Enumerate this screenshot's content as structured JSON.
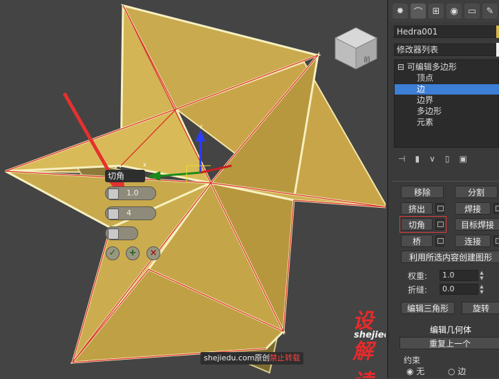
{
  "viewport": {
    "axis_z": "z",
    "axis_x": "x",
    "caddy": {
      "title": "切角",
      "amount": "1.0",
      "segments": "4"
    },
    "watermark": {
      "site": "shejiedu.com原创",
      "warning": "禁止转载"
    },
    "logo": {
      "big": "设解读",
      "small": "shejiedu.com"
    },
    "viewcube_label": "前"
  },
  "panel": {
    "object_name": "Hedra001",
    "modifier_list": "修改器列表",
    "stack": {
      "root": "可编辑多边形",
      "items": [
        "顶点",
        "边",
        "边界",
        "多边形",
        "元素"
      ],
      "selected": "边"
    },
    "edit_edges": {
      "remove": "移除",
      "split": "分割",
      "extrude": "挤出",
      "weld": "焊接",
      "chamfer": "切角",
      "target_weld": "目标焊接",
      "bridge": "桥",
      "connect": "连接",
      "create_shape": "利用所选内容创建图形",
      "weight_label": "权重:",
      "weight_value": "1.0",
      "crease_label": "折缝:",
      "crease_value": "0.0",
      "edit_tri": "编辑三角形",
      "turn": "旋转"
    },
    "edit_geometry": {
      "title": "编辑几何体",
      "repeat_last": "重复上一个",
      "constraints_label": "约束",
      "none": "无",
      "edge": "边"
    }
  }
}
